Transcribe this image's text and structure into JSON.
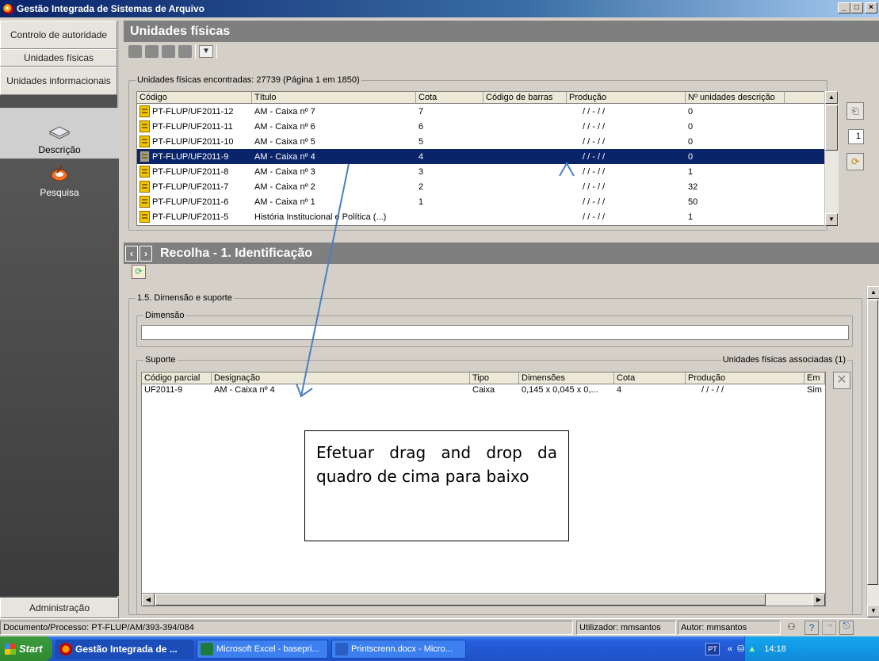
{
  "window": {
    "title": "Gestão Integrada de Sistemas de Arquivo",
    "min": "_",
    "max": "□",
    "close": "×"
  },
  "sidebar": {
    "top_buttons": [
      "Controlo de autoridade",
      "Unidades físicas",
      "Unidades informacionais"
    ],
    "items": [
      {
        "label": "Descrição",
        "icon": "book-icon"
      },
      {
        "label": "Pesquisa",
        "icon": "search-pen-icon"
      }
    ],
    "bottom_button": "Administração"
  },
  "section1": {
    "title": "Unidades físicas",
    "group_label": "Unidades físicas encontradas: 27739 (Página 1 em 1850)",
    "columns": [
      "Código",
      "Título",
      "Cota",
      "Código de barras",
      "Produção",
      "Nº unidades descrição"
    ],
    "rows": [
      {
        "codigo": "PT-FLUP/UF2011-12",
        "titulo": "AM - Caixa nº 7",
        "cota": "7",
        "barras": "",
        "producao": "/ /  -  / /",
        "n": "0",
        "selected": false
      },
      {
        "codigo": "PT-FLUP/UF2011-11",
        "titulo": "AM - Caixa nº 6",
        "cota": "6",
        "barras": "",
        "producao": "/ /  -  / /",
        "n": "0",
        "selected": false
      },
      {
        "codigo": "PT-FLUP/UF2011-10",
        "titulo": "AM - Caixa nº 5",
        "cota": "5",
        "barras": "",
        "producao": "/ /  -  / /",
        "n": "0",
        "selected": false
      },
      {
        "codigo": "PT-FLUP/UF2011-9",
        "titulo": "AM - Caixa nº 4",
        "cota": "4",
        "barras": "",
        "producao": "/ /  -  / /",
        "n": "0",
        "selected": true
      },
      {
        "codigo": "PT-FLUP/UF2011-8",
        "titulo": "AM - Caixa nº 3",
        "cota": "3",
        "barras": "",
        "producao": "/ /  -  / /",
        "n": "1",
        "selected": false
      },
      {
        "codigo": "PT-FLUP/UF2011-7",
        "titulo": "AM - Caixa nº 2",
        "cota": "2",
        "barras": "",
        "producao": "/ /  -  / /",
        "n": "32",
        "selected": false
      },
      {
        "codigo": "PT-FLUP/UF2011-6",
        "titulo": "AM - Caixa nº 1",
        "cota": "1",
        "barras": "",
        "producao": "/ /  -  / /",
        "n": "50",
        "selected": false
      },
      {
        "codigo": "PT-FLUP/UF2011-5",
        "titulo": "História Institucional e Política (...)",
        "cota": "",
        "barras": "",
        "producao": "/ /  -  / /",
        "n": "1",
        "selected": false
      }
    ],
    "page_number": "1"
  },
  "section2": {
    "title": "Recolha - 1. Identificação",
    "group_label": "1.5. Dimensão e suporte",
    "dimensao_label": "Dimensão",
    "dimensao_value": "",
    "suporte_label": "Suporte",
    "associated_label": "Unidades físicas associadas (1)",
    "columns": [
      "Código parcial",
      "Designação",
      "Tipo",
      "Dimensões",
      "Cota",
      "Produção",
      "Em"
    ],
    "rows": [
      {
        "codigo": "UF2011-9",
        "designacao": "AM - Caixa nº 4",
        "tipo": "Caixa",
        "dimensoes": "0,145 x 0,045 x 0,...",
        "cota": "4",
        "producao": "/ /  -  / /",
        "em": "Sim"
      }
    ]
  },
  "annotation": {
    "text": "Efetuar drag and drop da quadro de cima para baixo"
  },
  "statusbar": {
    "documento": "Documento/Processo: PT-FLUP/AM/393-394/084",
    "utilizador": "Utilizador: mmsantos",
    "autor": "Autor: mmsantos"
  },
  "taskbar": {
    "start": "Start",
    "tasks": [
      "Gestão Integrada de ...",
      "Microsoft Excel - basepri...",
      "Printscrenn.docx - Micro..."
    ],
    "lang": "PT",
    "time": "14:18"
  },
  "colors": {
    "selection": "#0a246a",
    "header_gray": "#7f7f7f",
    "sidebar_dark": "#515151",
    "arrow": "#4a7fc1"
  }
}
